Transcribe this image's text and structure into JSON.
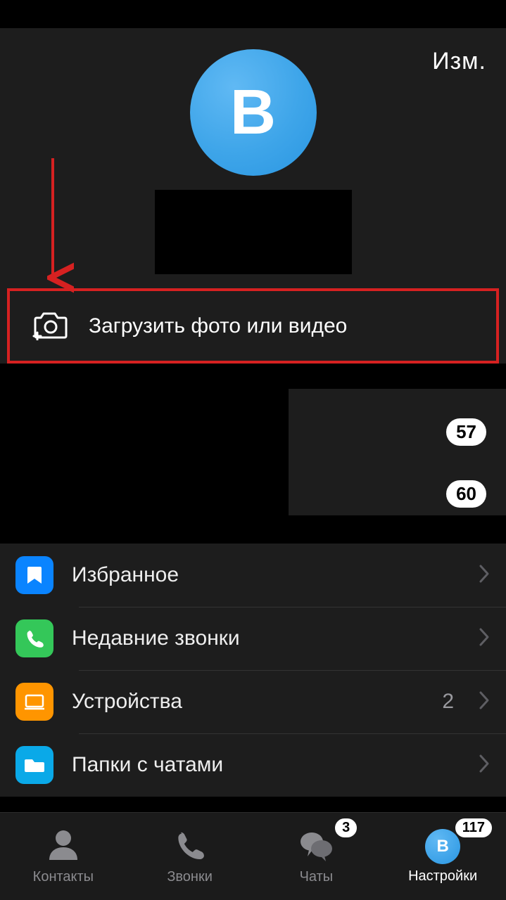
{
  "header": {
    "edit_label": "Изм.",
    "avatar_letter": "В"
  },
  "upload": {
    "label": "Загрузить фото или видео"
  },
  "info": {
    "badge1": "57",
    "badge2": "60"
  },
  "menu": {
    "favorites": {
      "label": "Избранное"
    },
    "recent_calls": {
      "label": "Недавние звонки"
    },
    "devices": {
      "label": "Устройства",
      "value": "2"
    },
    "chat_folders": {
      "label": "Папки с чатами"
    }
  },
  "tabbar": {
    "contacts": "Контакты",
    "calls": "Звонки",
    "chats": "Чаты",
    "chats_badge": "3",
    "settings": "Настройки",
    "settings_badge": "117",
    "settings_avatar_letter": "В"
  }
}
